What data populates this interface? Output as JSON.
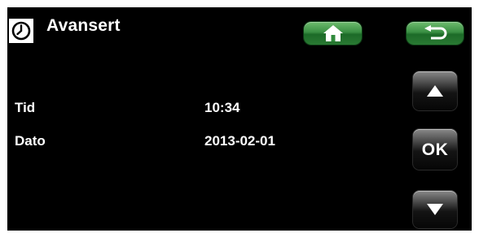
{
  "header": {
    "title": "Avansert",
    "icon": "clock-icon"
  },
  "toolbar": {
    "home_icon": "home-icon",
    "back_icon": "return-arrow-icon"
  },
  "settings": [
    {
      "label": "Tid",
      "value": "10:34"
    },
    {
      "label": "Dato",
      "value": "2013-02-01"
    }
  ],
  "nav": {
    "up_icon": "triangle-up-icon",
    "ok_label": "OK",
    "down_icon": "triangle-down-icon"
  },
  "colors": {
    "background": "#000000",
    "text": "#ffffff",
    "accent_green": "#2f8a3b"
  }
}
